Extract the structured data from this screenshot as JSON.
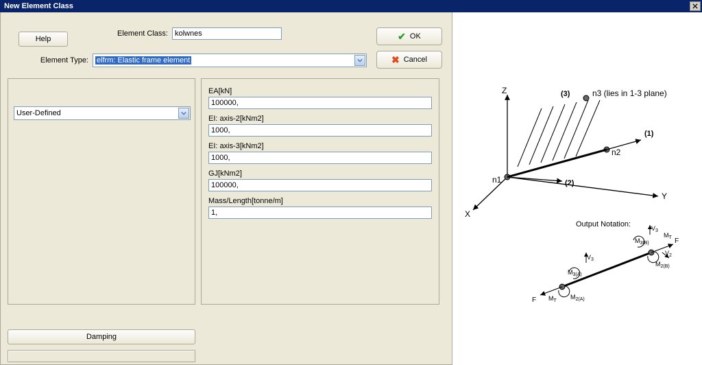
{
  "window": {
    "title": "New Element Class"
  },
  "buttons": {
    "help": "Help",
    "ok": "OK",
    "cancel": "Cancel",
    "damping": "Damping"
  },
  "labels": {
    "element_class": "Element Class:",
    "element_type": "Element Type:"
  },
  "fields": {
    "element_class_value": "kolwnes",
    "element_type_value": "elfrm: Elastic frame element",
    "section_source": "User-Defined"
  },
  "properties": {
    "ea_label": "EA[kN]",
    "ea_value": "100000,",
    "ei2_label": "EI: axis-2[kNm2]",
    "ei2_value": "1000,",
    "ei3_label": "EI: axis-3[kNm2]",
    "ei3_value": "1000,",
    "gj_label": "GJ[kNm2]",
    "gj_value": "100000,",
    "mass_label": "Mass/Length[tonne/m]",
    "mass_value": "1,"
  },
  "diagram": {
    "axis_x": "X",
    "axis_y": "Y",
    "axis_z": "Z",
    "n1": "n1",
    "n2": "n2",
    "n3": "n3 (lies in 1-3 plane)",
    "d1": "(1)",
    "d2": "(2)",
    "d3": "(3)",
    "output_title": "Output Notation:",
    "F": "F",
    "MT": "M",
    "M2A": "M",
    "M3A": "M",
    "M2B": "M",
    "M3B": "M",
    "V2": "V",
    "V3": "V"
  }
}
